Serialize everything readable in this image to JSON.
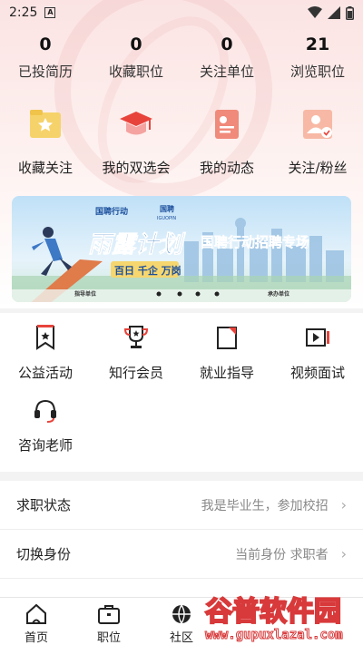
{
  "status_bar": {
    "time": "2:25",
    "notif_glyph": "A"
  },
  "stats": [
    {
      "value": "0",
      "label": "已投简历"
    },
    {
      "value": "0",
      "label": "收藏职位"
    },
    {
      "value": "0",
      "label": "关注单位"
    },
    {
      "value": "21",
      "label": "浏览职位"
    }
  ],
  "quick_links": [
    {
      "label": "收藏关注",
      "icon": "star-folder-icon"
    },
    {
      "label": "我的双选会",
      "icon": "graduation-cap-icon"
    },
    {
      "label": "我的动态",
      "icon": "profile-card-icon"
    },
    {
      "label": "关注/粉丝",
      "icon": "users-icon"
    }
  ],
  "banner": {
    "logo1": "国聘行动",
    "logo2": "国聘",
    "logo2_sub": "IGUOPIN",
    "headline": "雨露计划",
    "subhead": "国聘行动招聘专场",
    "tagline": "百日 千企 万岗",
    "footer_left": "指导单位",
    "footer_right": "承办单位"
  },
  "services": [
    {
      "label": "公益活动",
      "icon": "bookmark-star-icon"
    },
    {
      "label": "知行会员",
      "icon": "trophy-icon"
    },
    {
      "label": "就业指导",
      "icon": "document-corner-icon"
    },
    {
      "label": "视频面试",
      "icon": "video-play-icon"
    },
    {
      "label": "咨询老师",
      "icon": "headset-icon"
    }
  ],
  "settings": [
    {
      "key": "求职状态",
      "value": "我是毕业生，参加校招"
    },
    {
      "key": "切换身份",
      "value": "当前身份 求职者"
    }
  ],
  "tabs": [
    {
      "label": "首页",
      "icon": "home-icon"
    },
    {
      "label": "职位",
      "icon": "briefcase-icon"
    },
    {
      "label": "社区",
      "icon": "globe-icon"
    }
  ],
  "watermark": {
    "title": "谷普软件园",
    "url": "www.gupuxlazal.com"
  },
  "colors": {
    "accent": "#e8433b",
    "icon_bg": "#f4a3a0",
    "gold": "#f0c34a"
  }
}
